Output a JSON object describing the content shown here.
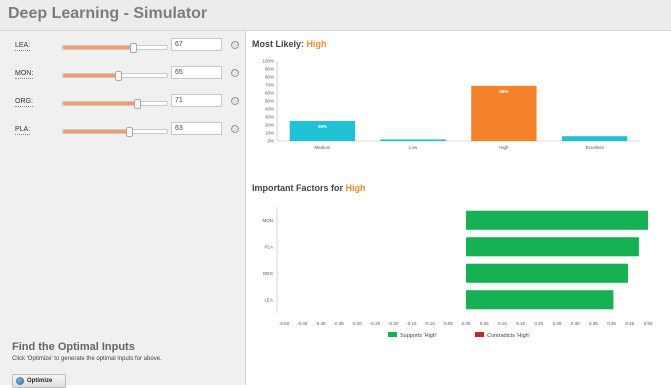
{
  "app": {
    "title": "Deep Learning - Simulator"
  },
  "sliders": [
    {
      "label": "LEA:",
      "value": "67",
      "level": 0.67
    },
    {
      "label": "MON:",
      "value": "65",
      "level": 0.53
    },
    {
      "label": "ORG:",
      "value": "71",
      "level": 0.71
    },
    {
      "label": "PLA:",
      "value": "63",
      "level": 0.63
    }
  ],
  "info_icon_glyph": "ⓘ",
  "optimal": {
    "heading": "Find the Optimal Inputs",
    "description": "Click 'Optimize' to generate the optimal inputs for above.",
    "button_label": "Optimize"
  },
  "likely": {
    "prefix": "Most Likely:",
    "value": "High"
  },
  "factors": {
    "prefix": "Important Factors for",
    "value": "High"
  },
  "colors": {
    "accent": "#f08a2c",
    "teal": "#1ec2d4",
    "orange": "#f5822a",
    "green": "#16b152",
    "red": "#c2272d"
  },
  "chart_data": [
    {
      "type": "bar",
      "categories": [
        "Medium",
        "Low",
        "High",
        "Excellent"
      ],
      "values": [
        25,
        2,
        69,
        6
      ],
      "labels": [
        "25%",
        "",
        "69%",
        ""
      ],
      "colors": [
        "#1ec2d4",
        "#1ec2d4",
        "#f5822a",
        "#1ec2d4"
      ],
      "ylim": [
        0,
        100
      ],
      "yticks": [
        "0%",
        "10%",
        "20%",
        "30%",
        "40%",
        "50%",
        "60%",
        "70%",
        "80%",
        "90%",
        "100%"
      ]
    },
    {
      "type": "bar",
      "orientation": "horizontal",
      "categories": [
        "MON",
        "PLA",
        "ORG",
        "LEA"
      ],
      "values": [
        0.5,
        0.475,
        0.445,
        0.405
      ],
      "xlim": [
        -0.5,
        0.5
      ],
      "xticks": [
        "-0.50",
        "-0.45",
        "-0.40",
        "-0.35",
        "-0.30",
        "-0.25",
        "-0.20",
        "-0.15",
        "-0.10",
        "-0.05",
        "0.00",
        "0.05",
        "0.10",
        "0.15",
        "0.20",
        "0.25",
        "0.30",
        "0.35",
        "0.40",
        "0.45",
        "0.50"
      ],
      "legend": [
        {
          "name": "Supports 'High'",
          "color": "#16b152"
        },
        {
          "name": "Contradicts 'High'",
          "color": "#c2272d"
        }
      ]
    }
  ]
}
